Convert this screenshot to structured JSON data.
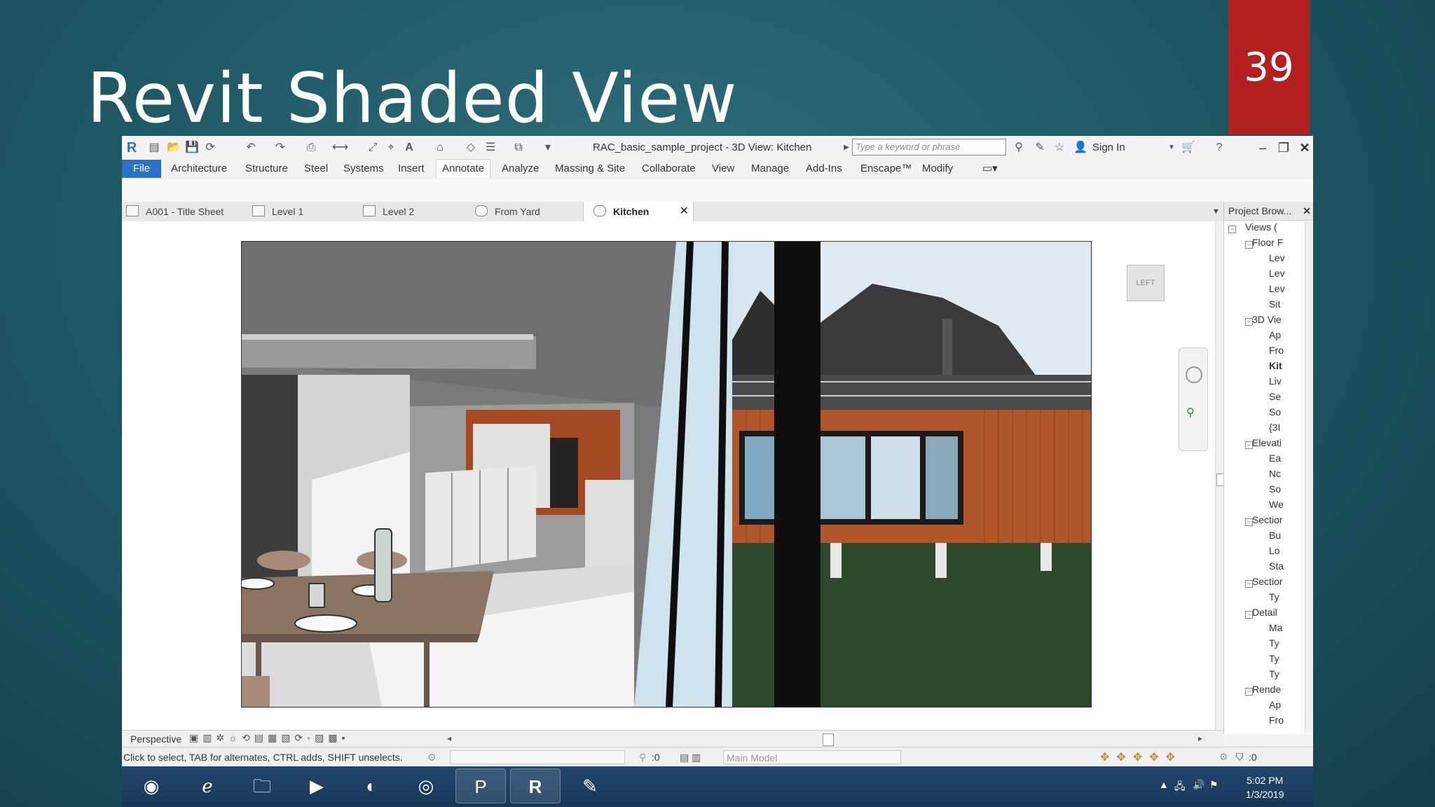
{
  "slide": {
    "title": "Revit Shaded View",
    "number": "39"
  },
  "app": {
    "title": "RAC_basic_sample_project - 3D View: Kitchen",
    "search_placeholder": "Type a keyword or phrase",
    "sign_in": "Sign In"
  },
  "ribbon": {
    "file": "File",
    "tabs": [
      "Architecture",
      "Structure",
      "Steel",
      "Systems",
      "Insert",
      "Annotate",
      "Analyze",
      "Massing & Site",
      "Collaborate",
      "View",
      "Manage",
      "Add-Ins",
      "Enscape™",
      "Modify"
    ],
    "active_tab": "Annotate"
  },
  "view_tabs": [
    {
      "label": "A001 - Title Sheet"
    },
    {
      "label": "Level 1"
    },
    {
      "label": "Level 2"
    },
    {
      "label": "From Yard"
    },
    {
      "label": "Kitchen",
      "active": true
    }
  ],
  "viewcube_label": "LEFT",
  "project_browser": {
    "title": "Project Brow...",
    "nodes": [
      "Views (",
      "Floor F",
      "Lev",
      "Lev",
      "Lev",
      "Sit",
      "3D Vie",
      "Ap",
      "Fro",
      "Kit",
      "Liv",
      "Se",
      "So",
      "{3I",
      "Elevati",
      "Ea",
      "Nc",
      "So",
      "We",
      "Sectior",
      "Bu",
      "Lo",
      "Sta",
      "Sectior",
      "Ty",
      "Detail",
      "Ma",
      "Ty",
      "Ty",
      "Ty",
      "Rende",
      "Ap",
      "Fro"
    ]
  },
  "view_control": {
    "mode": "Perspective"
  },
  "status": {
    "message": "Click to select, TAB for alternates, CTRL adds, SHIFT unselects.",
    "selection_count": ":0",
    "model": "Main Model",
    "filter_count": ":0"
  },
  "taskbar": {
    "time": "5:02 PM",
    "date": "1/3/2019"
  },
  "colors": {
    "slide_bg": "#1f5a66",
    "number_box": "#b41f1f",
    "file_tab": "#2a72c6",
    "siding": "#b0562a",
    "lawn": "#2e4a2d",
    "taskbar": "#1d3f63"
  }
}
